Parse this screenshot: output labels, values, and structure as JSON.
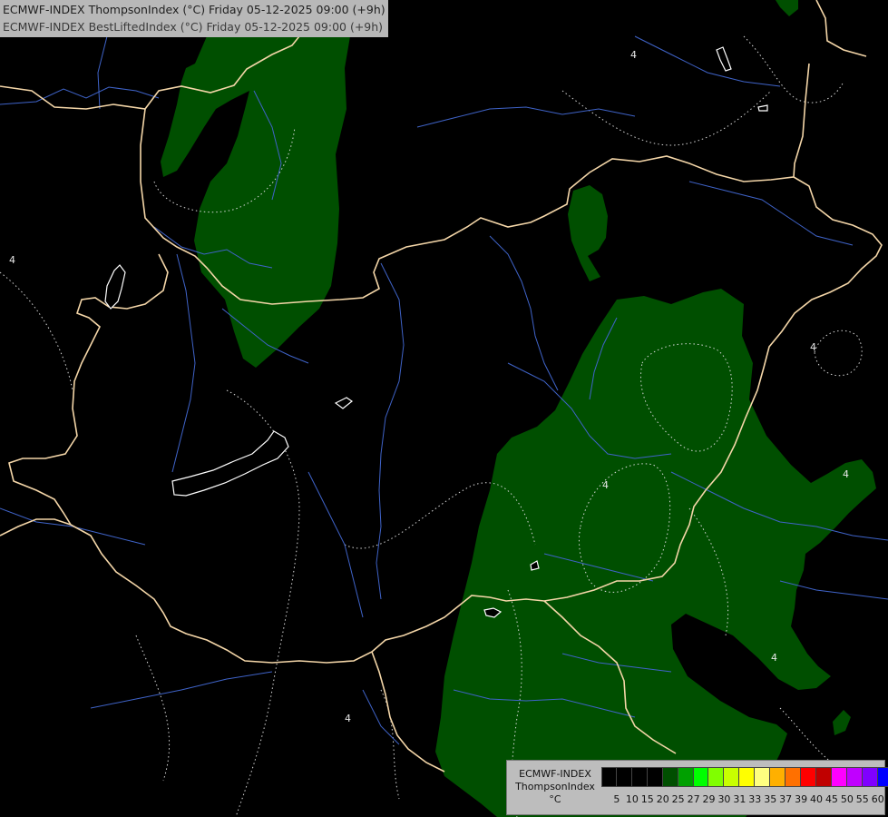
{
  "header": {
    "line1": "ECMWF-INDEX ThompsonIndex (°C) Friday 05-12-2025 09:00 (+9h)",
    "line2": "ECMWF-INDEX BestLiftedIndex (°C) Friday 05-12-2025 09:00 (+9h)"
  },
  "legend": {
    "title_line1": "ECMWF-INDEX",
    "title_line2": "ThompsonIndex",
    "unit": "°C",
    "ticks": [
      "5",
      "10",
      "15",
      "20",
      "25",
      "27",
      "29",
      "30",
      "31",
      "33",
      "35",
      "37",
      "39",
      "40",
      "45",
      "50",
      "55",
      "60"
    ],
    "colors": [
      "#000000",
      "#000000",
      "#000000",
      "#000000",
      "#004f00",
      "#00a000",
      "#00ff00",
      "#80ff00",
      "#c8ff00",
      "#ffff00",
      "#ffff80",
      "#ffb000",
      "#ff7000",
      "#ff0000",
      "#c00000",
      "#ff00ff",
      "#c000ff",
      "#8000ff",
      "#0000ff"
    ]
  },
  "map_overlay": {
    "contour_label": "4",
    "colors": {
      "green_fill": "#004f00",
      "border": "#f4d6a8",
      "river": "#3f63c8",
      "dotted_contour": "#d8d8d8",
      "lake_outline": "#ffffff"
    }
  }
}
